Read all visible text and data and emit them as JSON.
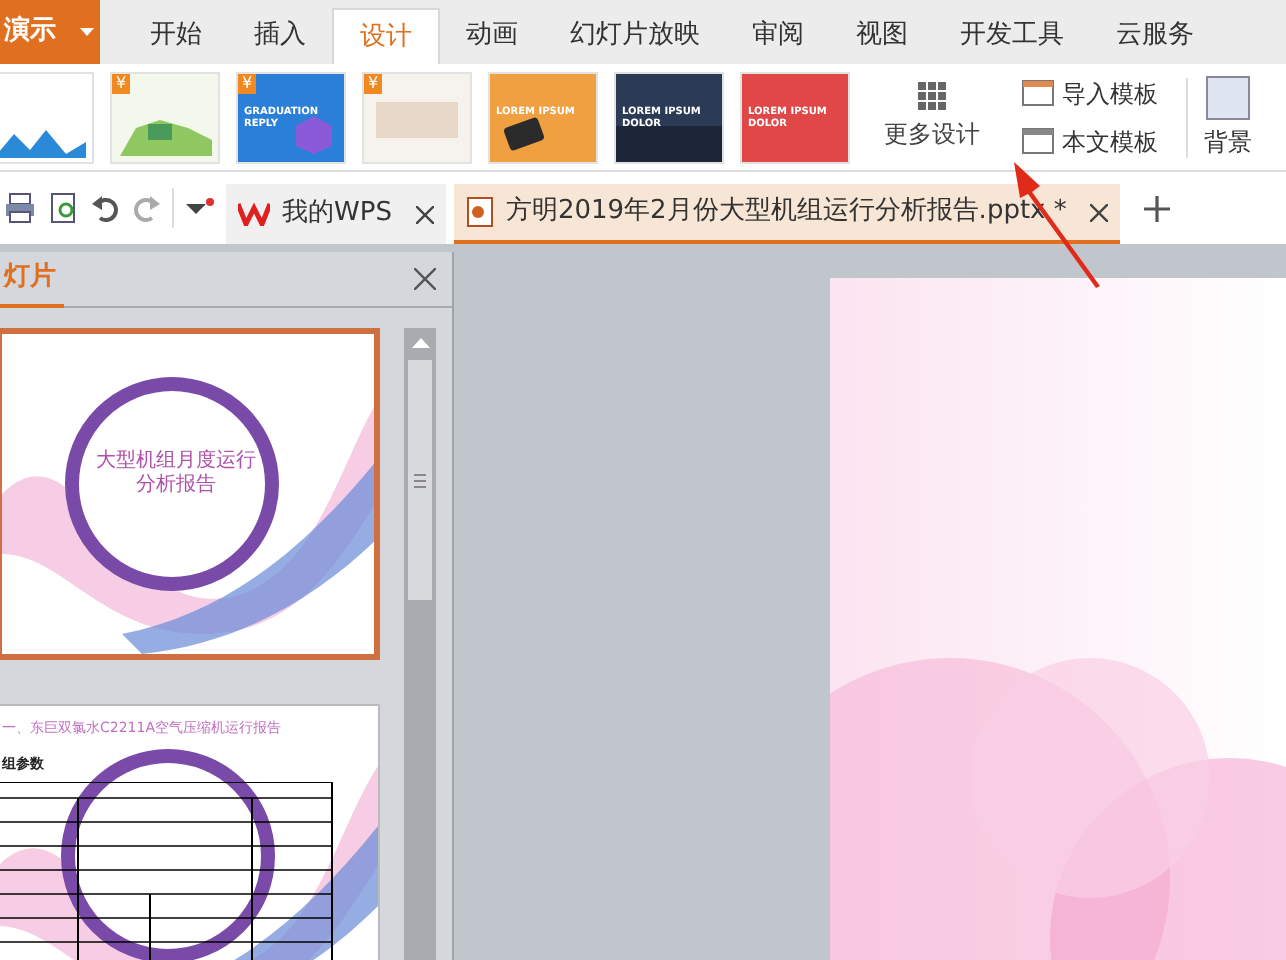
{
  "app_button": {
    "label": "演示"
  },
  "menu_tabs": [
    {
      "label": "开始",
      "selected": false
    },
    {
      "label": "插入",
      "selected": false
    },
    {
      "label": "设计",
      "selected": true
    },
    {
      "label": "动画",
      "selected": false
    },
    {
      "label": "幻灯片放映",
      "selected": false
    },
    {
      "label": "审阅",
      "selected": false
    },
    {
      "label": "视图",
      "selected": false
    },
    {
      "label": "开发工具",
      "selected": false
    },
    {
      "label": "云服务",
      "selected": false
    }
  ],
  "templates": [
    {
      "kind": "mountains"
    },
    {
      "kind": "city",
      "badge": "¥"
    },
    {
      "kind": "graduation",
      "badge": "¥",
      "caption": "GRADUATION REPLY"
    },
    {
      "kind": "sunset",
      "badge": "¥"
    },
    {
      "kind": "orange",
      "caption": "LOREM IPSUM"
    },
    {
      "kind": "dark",
      "caption": "LOREM IPSUM DOLOR"
    },
    {
      "kind": "red",
      "caption": "LOREM IPSUM DOLOR"
    }
  ],
  "more_design": {
    "label": "更多设计"
  },
  "template_actions": [
    {
      "label": "导入模板"
    },
    {
      "label": "本文模板"
    }
  ],
  "background_button": {
    "label": "背景"
  },
  "doc_tabs": [
    {
      "label": "我的WPS",
      "kind": "home",
      "selected": false
    },
    {
      "label": "方明2019年2月份大型机组运行分析报告.pptx *",
      "kind": "document",
      "selected": true
    }
  ],
  "slides_panel": {
    "title": "灯片",
    "slides": [
      {
        "kind": "cover",
        "selected": true,
        "title": "大型机组月度运行分析报告"
      },
      {
        "kind": "table",
        "selected": false,
        "title": "一、东巨双氯水C2211A空气压缩机运行报告",
        "subtitle": "组参数"
      }
    ]
  }
}
